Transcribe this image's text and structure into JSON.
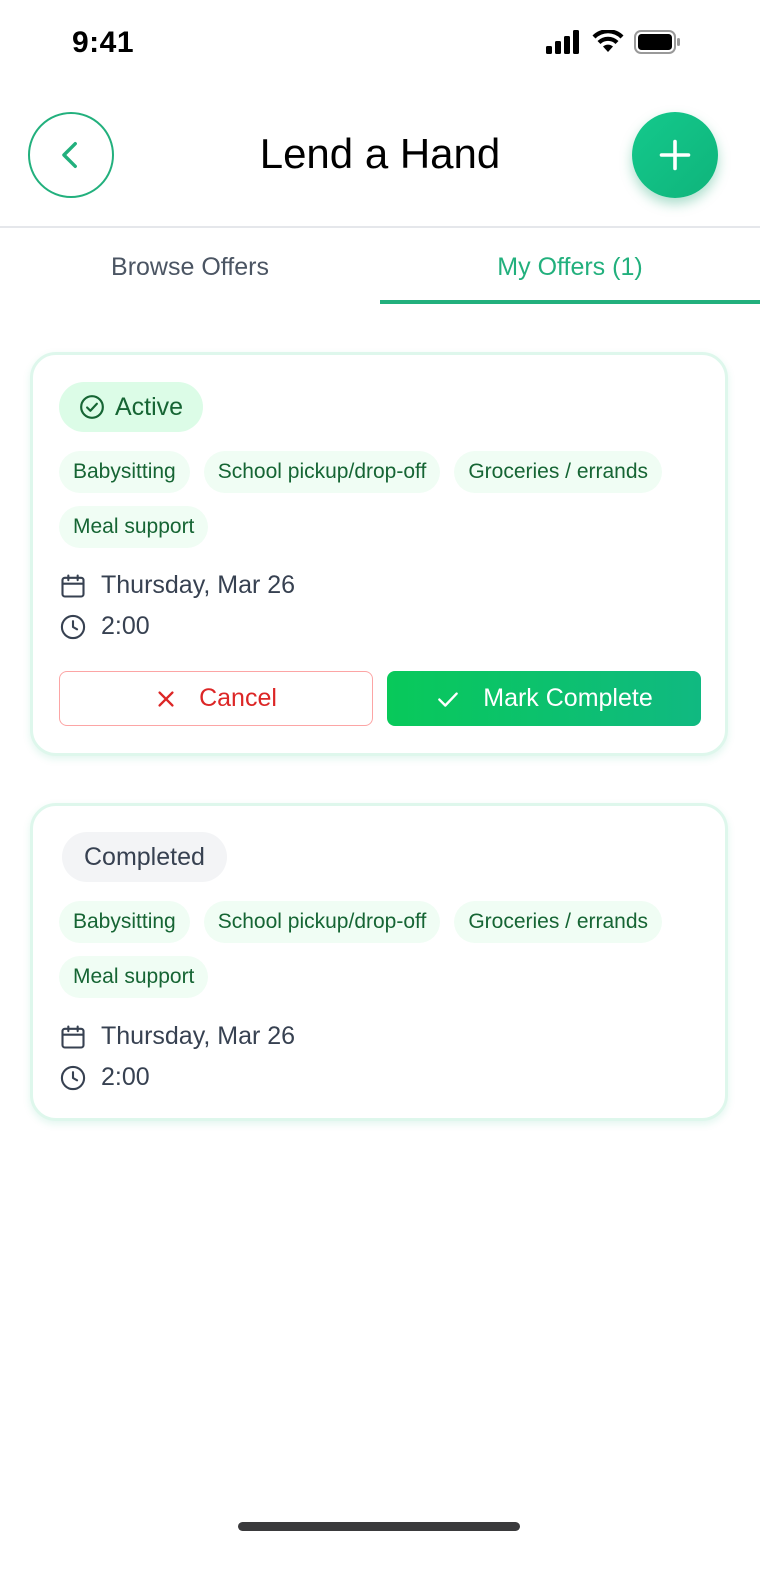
{
  "status_bar": {
    "time": "9:41"
  },
  "header": {
    "title": "Lend a Hand",
    "back_icon": "chevron-left-icon",
    "add_icon": "plus-icon"
  },
  "tabs": [
    {
      "label": "Browse Offers",
      "selected": false
    },
    {
      "label": "My Offers (1)",
      "selected": true
    }
  ],
  "offers": [
    {
      "status": "Active",
      "tags": [
        "Babysitting",
        "School pickup/drop-off",
        "Groceries / errands",
        "Meal support"
      ],
      "date": "Thursday, Mar 26",
      "time": "2:00",
      "actions": {
        "cancel": "Cancel",
        "complete": "Mark Complete"
      }
    },
    {
      "status": "Completed",
      "tags": [
        "Babysitting",
        "School pickup/drop-off",
        "Groceries / errands",
        "Meal support"
      ],
      "date": "Thursday, Mar 26",
      "time": "2:00"
    }
  ],
  "colors": {
    "accent": "#22b07d",
    "active_badge_bg": "#dcfce7",
    "tag_bg": "#f0fdf4",
    "tag_text": "#166534",
    "cancel": "#dc2626",
    "complete_start": "#08c95a",
    "complete_end": "#10b981"
  }
}
